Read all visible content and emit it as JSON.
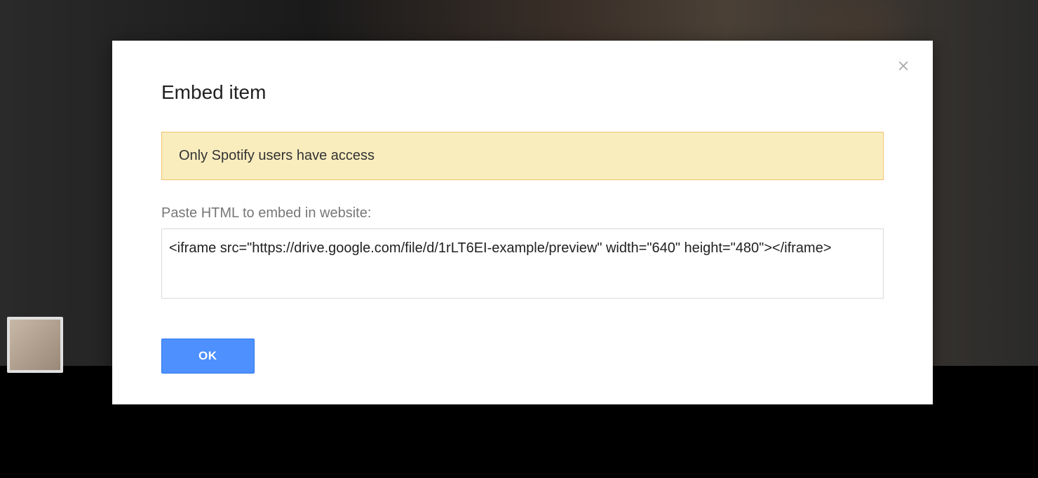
{
  "modal": {
    "title": "Embed item",
    "warning_message": "Only Spotify users have access",
    "field_label": "Paste HTML to embed in website:",
    "embed_code": "<iframe src=\"https://drive.google.com/file/d/1rLT6EI-example/preview\" width=\"640\" height=\"480\"></iframe>",
    "ok_label": "OK"
  }
}
